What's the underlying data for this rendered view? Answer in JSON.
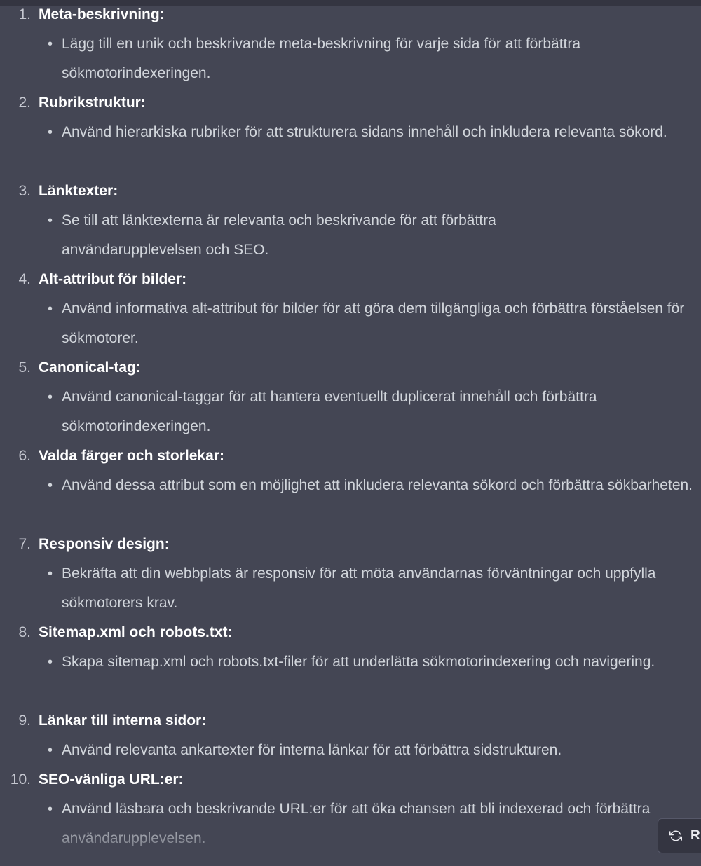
{
  "items": [
    {
      "num": "1.",
      "title": "Meta-beskrivning:",
      "text": "Lägg till en unik och beskrivande meta-beskrivning för varje sida för att förbättra sökmotorindexeringen."
    },
    {
      "num": "2.",
      "title": "Rubrikstruktur:",
      "text": "Använd hierarkiska rubriker för att strukturera sidans innehåll och inkludera relevanta sökord."
    },
    {
      "num": "3.",
      "title": "Länktexter:",
      "text": "Se till att länktexterna är relevanta och beskrivande för att förbättra användarupplevelsen och SEO."
    },
    {
      "num": "4.",
      "title": "Alt-attribut för bilder:",
      "text": "Använd informativa alt-attribut för bilder för att göra dem tillgängliga och förbättra förståelsen för sökmotorer."
    },
    {
      "num": "5.",
      "title": "Canonical-tag:",
      "text": "Använd canonical-taggar för att hantera eventuellt duplicerat innehåll och förbättra sökmotorindexeringen."
    },
    {
      "num": "6.",
      "title": "Valda färger och storlekar:",
      "text": "Använd dessa attribut som en möjlighet att inkludera relevanta sökord och förbättra sökbarheten."
    },
    {
      "num": "7.",
      "title": "Responsiv design:",
      "text": "Bekräfta att din webbplats är responsiv för att möta användarnas förväntningar och uppfylla sökmotorers krav."
    },
    {
      "num": "8.",
      "title": "Sitemap.xml och robots.txt:",
      "text": "Skapa sitemap.xml och robots.txt-filer för att underlätta sökmotorindexering och navigering."
    },
    {
      "num": "9.",
      "title": "Länkar till interna sidor:",
      "text": "Använd relevanta ankartexter för interna länkar för att förbättra sidstrukturen."
    },
    {
      "num": "10.",
      "title": "SEO-vänliga URL:er:",
      "text": "Använd läsbara och beskrivande URL:er för att öka chansen att bli indexerad och förbättra användarupplevelsen."
    }
  ],
  "regenerate_button": {
    "label": "R",
    "icon": "regenerate-icon"
  },
  "colors": {
    "background": "#444654",
    "title": "#ffffff",
    "body": "#d1d5db"
  }
}
